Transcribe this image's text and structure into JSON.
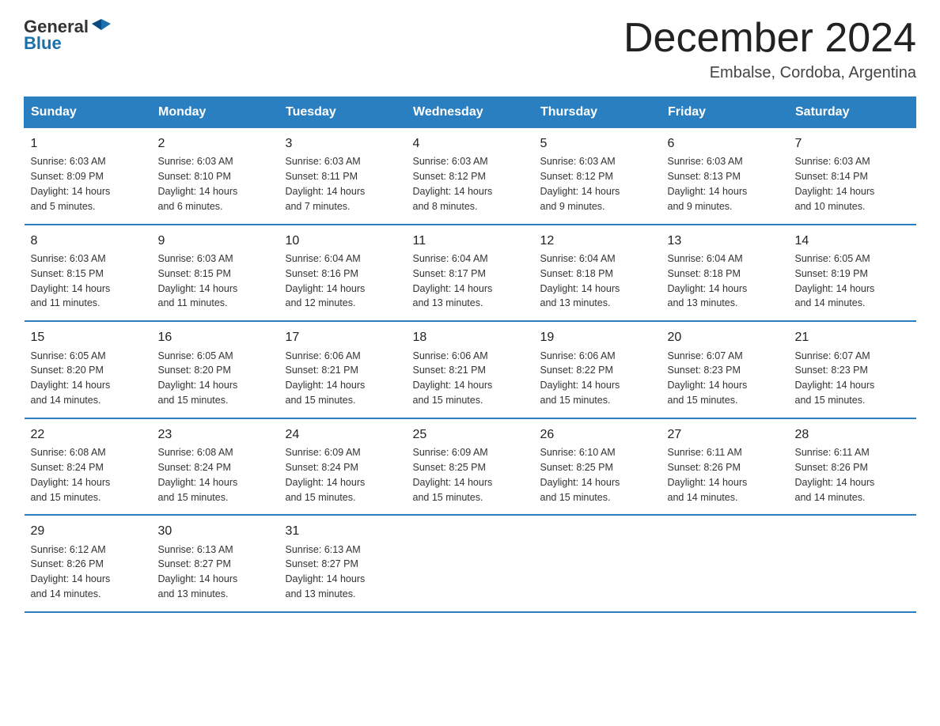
{
  "header": {
    "logo_general": "General",
    "logo_blue": "Blue",
    "title": "December 2024",
    "subtitle": "Embalse, Cordoba, Argentina"
  },
  "days_of_week": [
    "Sunday",
    "Monday",
    "Tuesday",
    "Wednesday",
    "Thursday",
    "Friday",
    "Saturday"
  ],
  "weeks": [
    [
      {
        "day": "1",
        "sunrise": "6:03 AM",
        "sunset": "8:09 PM",
        "daylight": "14 hours and 5 minutes."
      },
      {
        "day": "2",
        "sunrise": "6:03 AM",
        "sunset": "8:10 PM",
        "daylight": "14 hours and 6 minutes."
      },
      {
        "day": "3",
        "sunrise": "6:03 AM",
        "sunset": "8:11 PM",
        "daylight": "14 hours and 7 minutes."
      },
      {
        "day": "4",
        "sunrise": "6:03 AM",
        "sunset": "8:12 PM",
        "daylight": "14 hours and 8 minutes."
      },
      {
        "day": "5",
        "sunrise": "6:03 AM",
        "sunset": "8:12 PM",
        "daylight": "14 hours and 9 minutes."
      },
      {
        "day": "6",
        "sunrise": "6:03 AM",
        "sunset": "8:13 PM",
        "daylight": "14 hours and 9 minutes."
      },
      {
        "day": "7",
        "sunrise": "6:03 AM",
        "sunset": "8:14 PM",
        "daylight": "14 hours and 10 minutes."
      }
    ],
    [
      {
        "day": "8",
        "sunrise": "6:03 AM",
        "sunset": "8:15 PM",
        "daylight": "14 hours and 11 minutes."
      },
      {
        "day": "9",
        "sunrise": "6:03 AM",
        "sunset": "8:15 PM",
        "daylight": "14 hours and 11 minutes."
      },
      {
        "day": "10",
        "sunrise": "6:04 AM",
        "sunset": "8:16 PM",
        "daylight": "14 hours and 12 minutes."
      },
      {
        "day": "11",
        "sunrise": "6:04 AM",
        "sunset": "8:17 PM",
        "daylight": "14 hours and 13 minutes."
      },
      {
        "day": "12",
        "sunrise": "6:04 AM",
        "sunset": "8:18 PM",
        "daylight": "14 hours and 13 minutes."
      },
      {
        "day": "13",
        "sunrise": "6:04 AM",
        "sunset": "8:18 PM",
        "daylight": "14 hours and 13 minutes."
      },
      {
        "day": "14",
        "sunrise": "6:05 AM",
        "sunset": "8:19 PM",
        "daylight": "14 hours and 14 minutes."
      }
    ],
    [
      {
        "day": "15",
        "sunrise": "6:05 AM",
        "sunset": "8:20 PM",
        "daylight": "14 hours and 14 minutes."
      },
      {
        "day": "16",
        "sunrise": "6:05 AM",
        "sunset": "8:20 PM",
        "daylight": "14 hours and 15 minutes."
      },
      {
        "day": "17",
        "sunrise": "6:06 AM",
        "sunset": "8:21 PM",
        "daylight": "14 hours and 15 minutes."
      },
      {
        "day": "18",
        "sunrise": "6:06 AM",
        "sunset": "8:21 PM",
        "daylight": "14 hours and 15 minutes."
      },
      {
        "day": "19",
        "sunrise": "6:06 AM",
        "sunset": "8:22 PM",
        "daylight": "14 hours and 15 minutes."
      },
      {
        "day": "20",
        "sunrise": "6:07 AM",
        "sunset": "8:23 PM",
        "daylight": "14 hours and 15 minutes."
      },
      {
        "day": "21",
        "sunrise": "6:07 AM",
        "sunset": "8:23 PM",
        "daylight": "14 hours and 15 minutes."
      }
    ],
    [
      {
        "day": "22",
        "sunrise": "6:08 AM",
        "sunset": "8:24 PM",
        "daylight": "14 hours and 15 minutes."
      },
      {
        "day": "23",
        "sunrise": "6:08 AM",
        "sunset": "8:24 PM",
        "daylight": "14 hours and 15 minutes."
      },
      {
        "day": "24",
        "sunrise": "6:09 AM",
        "sunset": "8:24 PM",
        "daylight": "14 hours and 15 minutes."
      },
      {
        "day": "25",
        "sunrise": "6:09 AM",
        "sunset": "8:25 PM",
        "daylight": "14 hours and 15 minutes."
      },
      {
        "day": "26",
        "sunrise": "6:10 AM",
        "sunset": "8:25 PM",
        "daylight": "14 hours and 15 minutes."
      },
      {
        "day": "27",
        "sunrise": "6:11 AM",
        "sunset": "8:26 PM",
        "daylight": "14 hours and 14 minutes."
      },
      {
        "day": "28",
        "sunrise": "6:11 AM",
        "sunset": "8:26 PM",
        "daylight": "14 hours and 14 minutes."
      }
    ],
    [
      {
        "day": "29",
        "sunrise": "6:12 AM",
        "sunset": "8:26 PM",
        "daylight": "14 hours and 14 minutes."
      },
      {
        "day": "30",
        "sunrise": "6:13 AM",
        "sunset": "8:27 PM",
        "daylight": "14 hours and 13 minutes."
      },
      {
        "day": "31",
        "sunrise": "6:13 AM",
        "sunset": "8:27 PM",
        "daylight": "14 hours and 13 minutes."
      },
      null,
      null,
      null,
      null
    ]
  ],
  "labels": {
    "sunrise": "Sunrise:",
    "sunset": "Sunset:",
    "daylight": "Daylight:"
  }
}
